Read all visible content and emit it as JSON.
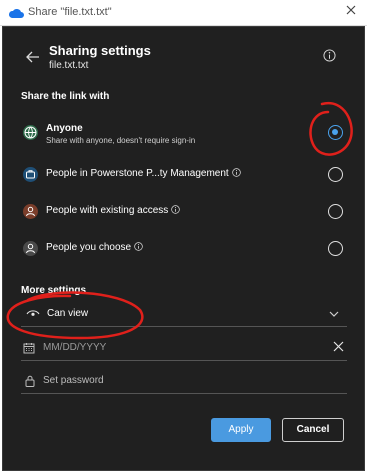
{
  "window": {
    "title": "Share \"file.txt.txt\""
  },
  "header": {
    "title": "Sharing settings",
    "filename": "file.txt.txt"
  },
  "share_section": {
    "title": "Share the link with"
  },
  "options": [
    {
      "label": "Anyone",
      "sub": "Share with anyone, doesn't require sign-in",
      "selected": true,
      "icon": "globe-icon"
    },
    {
      "label": "People in Powerstone P...ty Management",
      "selected": false,
      "icon": "briefcase-icon"
    },
    {
      "label": "People with existing access",
      "selected": false,
      "icon": "person-icon"
    },
    {
      "label": "People you choose",
      "selected": false,
      "icon": "person-icon"
    }
  ],
  "more_settings": {
    "title": "More settings",
    "permission": "Can view",
    "date_placeholder": "MM/DD/YYYY",
    "password_placeholder": "Set password"
  },
  "buttons": {
    "apply": "Apply",
    "cancel": "Cancel"
  },
  "colors": {
    "accent": "#4aa3ee",
    "annotation": "#e0201b",
    "panel": "#202020"
  }
}
